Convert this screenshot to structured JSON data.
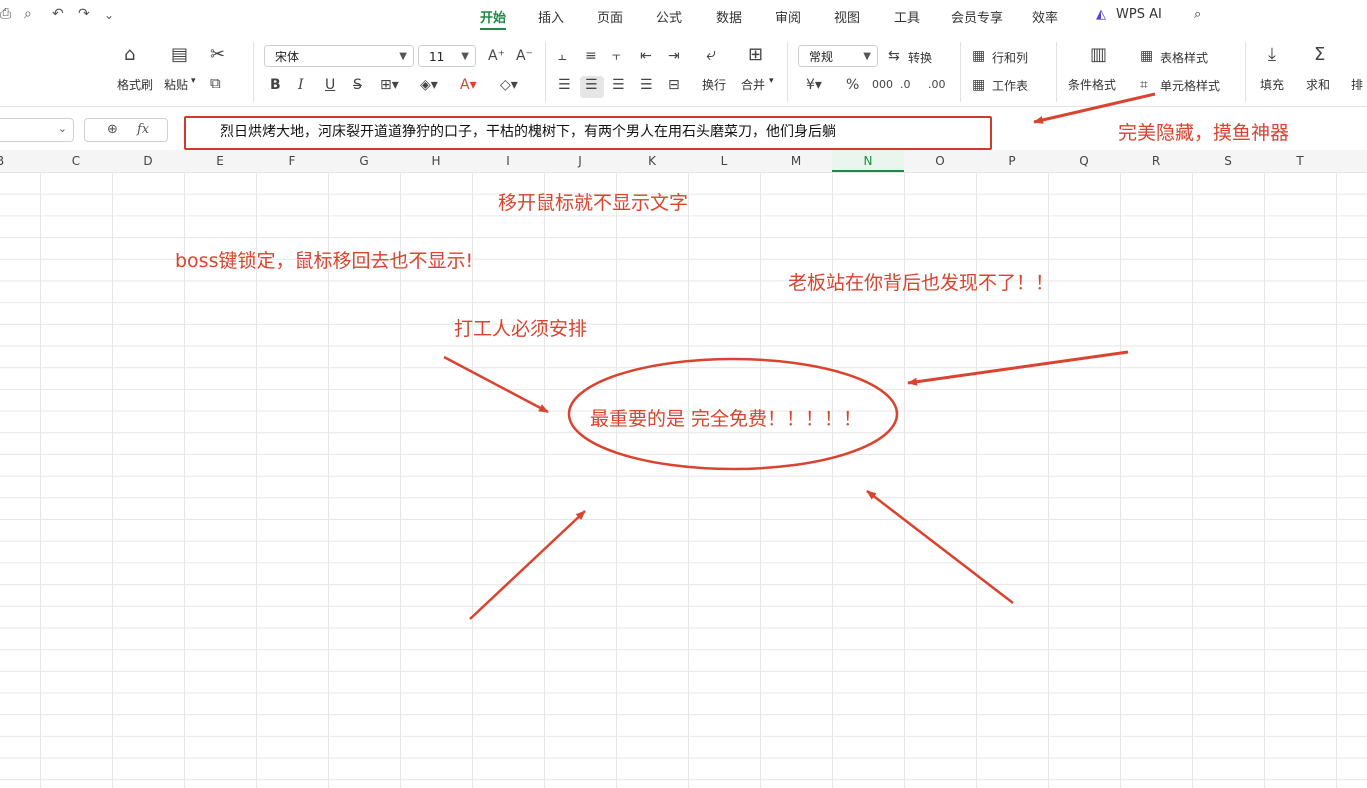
{
  "tabs": [
    "开始",
    "插入",
    "页面",
    "公式",
    "数据",
    "审阅",
    "视图",
    "工具",
    "会员专享",
    "效率",
    "WPS AI"
  ],
  "active_tab": "开始",
  "ribbon": {
    "format_painter": "格式刷",
    "paste": "粘贴",
    "font_name": "宋体",
    "font_size": "11",
    "bold": "B",
    "italic": "I",
    "underline": "U",
    "wrap": "换行",
    "merge": "合并",
    "number_format": "常规",
    "convert": "转换",
    "rows_cols": "行和列",
    "worksheet": "工作表",
    "cond_format": "条件格式",
    "table_style": "表格样式",
    "cell_style": "单元格样式",
    "fill": "填充",
    "sum": "求和",
    "sort": "排"
  },
  "formula_bar": {
    "fx": "fx",
    "content": "烈日烘烤大地，河床裂开道道狰狞的口子，干枯的槐树下，有两个男人在用石头磨菜刀，他们身后躺"
  },
  "columns": [
    "B",
    "C",
    "D",
    "E",
    "F",
    "G",
    "H",
    "I",
    "J",
    "K",
    "L",
    "M",
    "N",
    "O",
    "P",
    "Q",
    "R",
    "S",
    "T"
  ],
  "active_column": "N",
  "annotations": {
    "perfect_hide": "完美隐藏，摸鱼神器",
    "move_mouse": "移开鼠标就不显示文字",
    "boss_key": "boss键锁定，鼠标移回去也不显示!",
    "boss_behind": "老板站在你背后也发现不了！！",
    "must_have": "打工人必须安排",
    "free": "最重要的是 完全免费！！！！！"
  },
  "accent_color": "#d9432f",
  "active_color": "#1e8a46"
}
